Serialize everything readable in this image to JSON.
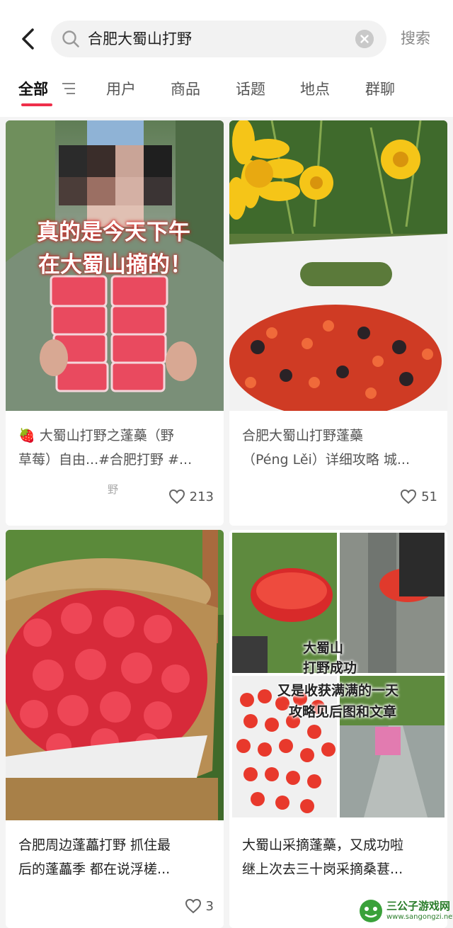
{
  "search": {
    "query": "合肥大蜀山打野",
    "submit_label": "搜索"
  },
  "tabs": [
    {
      "label": "全部"
    },
    {
      "label": "用户"
    },
    {
      "label": "商品"
    },
    {
      "label": "话题"
    },
    {
      "label": "地点"
    },
    {
      "label": "群聊"
    }
  ],
  "accent_color": "#ef2f4a",
  "cards": [
    {
      "title": "🍓 大蜀山打野之蓬蘽（野\n草莓）自由...#合肥打野 #...",
      "overlay_lines": [
        "真的是今天下午",
        "在大蜀山摘的！"
      ],
      "author_fragment": "野",
      "likes": "213"
    },
    {
      "title": "合肥大蜀山打野蓬蘽\n（Péng Lěi）详细攻略 城...",
      "likes": "51"
    },
    {
      "title": "合肥周边蓬藟打野 抓住最\n后的蓬藟季 都在说浮槎...",
      "likes": "3"
    },
    {
      "title": "大蜀山采摘蓬蘽，又成功啦\n继上次去三十岗采摘桑葚...",
      "overlay_lines": [
        "大蜀山",
        "打野成功",
        "又是收获满满的一天",
        "攻略见后图和文章"
      ]
    }
  ],
  "watermark": {
    "name": "三公子游戏网",
    "url": "www.sangongzi.net"
  },
  "icons": [
    "back-arrow-icon",
    "search-icon",
    "clear-icon",
    "filter-icon",
    "heart-icon",
    "strawberry-icon"
  ]
}
